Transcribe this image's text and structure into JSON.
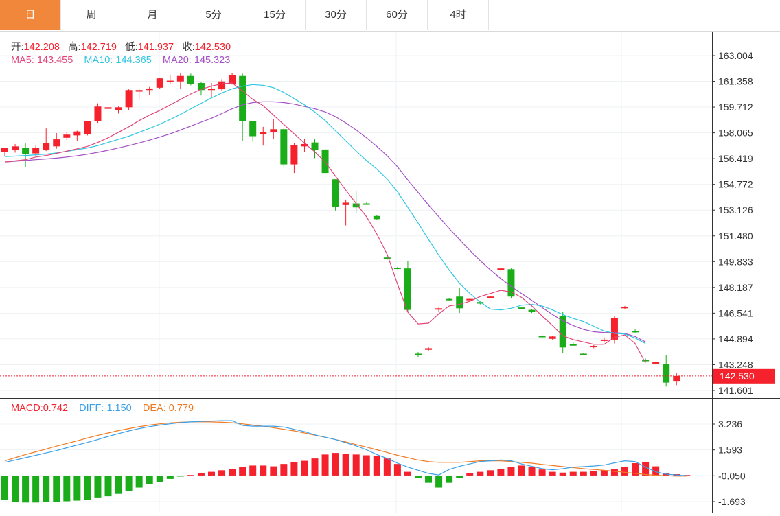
{
  "tabs": [
    "日",
    "周",
    "月",
    "5分",
    "15分",
    "30分",
    "60分",
    "4时"
  ],
  "active_tab": 0,
  "ohlc": {
    "open_label": "开:",
    "open": "142.208",
    "high_label": "高:",
    "high": "142.719",
    "low_label": "低:",
    "low": "141.937",
    "close_label": "收:",
    "close": "142.530"
  },
  "ma": {
    "ma5_label": "MA5:",
    "ma5": "143.455",
    "ma10_label": "MA10:",
    "ma10": "144.365",
    "ma20_label": "MA20:",
    "ma20": "145.323"
  },
  "macd": {
    "macd_label": "MACD:",
    "macd": "0.742",
    "diff_label": "DIFF:",
    "diff": "1.150",
    "dea_label": "DEA:",
    "dea": "0.779"
  },
  "colors": {
    "up": "#f5222d",
    "down": "#1aad19",
    "ma5": "#e0457b",
    "ma10": "#2ec7e0",
    "ma20": "#a34fc4",
    "diff": "#3aa0e8",
    "dea": "#f07a22",
    "active_tab": "#f0873a"
  },
  "chart_data": [
    {
      "type": "candlestick",
      "price_axis_ticks": [
        "163.004",
        "161.358",
        "159.712",
        "158.065",
        "156.419",
        "154.772",
        "153.126",
        "151.480",
        "149.833",
        "148.187",
        "146.541",
        "144.894",
        "143.248",
        "141.601"
      ],
      "ylim": [
        141.0,
        164.0
      ],
      "last_price_label": "142.530",
      "last_price": 142.53,
      "grid": true,
      "candles": [
        {
          "o": 156.85,
          "h": 157.1,
          "l": 156.55,
          "c": 157.1
        },
        {
          "o": 156.95,
          "h": 157.35,
          "l": 156.8,
          "c": 157.2
        },
        {
          "o": 157.1,
          "h": 157.4,
          "l": 155.9,
          "c": 156.7
        },
        {
          "o": 156.75,
          "h": 157.25,
          "l": 156.55,
          "c": 157.1
        },
        {
          "o": 156.95,
          "h": 158.35,
          "l": 156.9,
          "c": 157.4
        },
        {
          "o": 157.2,
          "h": 158.05,
          "l": 157.05,
          "c": 157.65
        },
        {
          "o": 157.75,
          "h": 158.1,
          "l": 157.6,
          "c": 157.95
        },
        {
          "o": 157.9,
          "h": 158.2,
          "l": 157.55,
          "c": 158.15
        },
        {
          "o": 158.0,
          "h": 158.8,
          "l": 157.9,
          "c": 158.8
        },
        {
          "o": 158.8,
          "h": 159.95,
          "l": 158.7,
          "c": 159.75
        },
        {
          "o": 159.6,
          "h": 160.0,
          "l": 159.05,
          "c": 159.7
        },
        {
          "o": 159.5,
          "h": 159.75,
          "l": 159.3,
          "c": 159.7
        },
        {
          "o": 159.7,
          "h": 160.85,
          "l": 159.5,
          "c": 160.8
        },
        {
          "o": 160.7,
          "h": 160.9,
          "l": 160.2,
          "c": 160.8
        },
        {
          "o": 160.8,
          "h": 161.0,
          "l": 160.5,
          "c": 160.9
        },
        {
          "o": 160.95,
          "h": 161.6,
          "l": 160.85,
          "c": 161.55
        },
        {
          "o": 161.35,
          "h": 161.75,
          "l": 161.15,
          "c": 161.4
        },
        {
          "o": 161.35,
          "h": 161.9,
          "l": 160.85,
          "c": 161.7
        },
        {
          "o": 161.7,
          "h": 161.85,
          "l": 161.1,
          "c": 161.2
        },
        {
          "o": 161.25,
          "h": 161.3,
          "l": 160.45,
          "c": 160.8
        },
        {
          "o": 160.8,
          "h": 161.25,
          "l": 160.35,
          "c": 160.9
        },
        {
          "o": 160.85,
          "h": 161.5,
          "l": 160.75,
          "c": 161.35
        },
        {
          "o": 161.2,
          "h": 161.9,
          "l": 161.15,
          "c": 161.75
        },
        {
          "o": 161.7,
          "h": 161.85,
          "l": 157.55,
          "c": 158.8
        },
        {
          "o": 158.8,
          "h": 158.8,
          "l": 157.5,
          "c": 157.85
        },
        {
          "o": 158.0,
          "h": 158.45,
          "l": 157.25,
          "c": 158.1
        },
        {
          "o": 158.1,
          "h": 158.95,
          "l": 157.65,
          "c": 158.3
        },
        {
          "o": 158.3,
          "h": 158.4,
          "l": 155.9,
          "c": 156.05
        },
        {
          "o": 156.05,
          "h": 157.4,
          "l": 155.5,
          "c": 157.3
        },
        {
          "o": 157.2,
          "h": 157.7,
          "l": 156.85,
          "c": 157.35
        },
        {
          "o": 157.45,
          "h": 157.65,
          "l": 156.45,
          "c": 156.95
        },
        {
          "o": 157.0,
          "h": 157.05,
          "l": 155.4,
          "c": 155.5
        },
        {
          "o": 155.1,
          "h": 155.1,
          "l": 153.1,
          "c": 153.35
        },
        {
          "o": 153.45,
          "h": 153.8,
          "l": 152.15,
          "c": 153.6
        },
        {
          "o": 153.55,
          "h": 154.35,
          "l": 152.95,
          "c": 153.3
        },
        {
          "o": 153.55,
          "h": 153.6,
          "l": 153.5,
          "c": 153.5
        },
        {
          "o": 152.75,
          "h": 152.8,
          "l": 152.5,
          "c": 152.55
        },
        {
          "o": 150.1,
          "h": 150.15,
          "l": 149.95,
          "c": 150.0
        },
        {
          "o": 149.45,
          "h": 149.5,
          "l": 149.35,
          "c": 149.4
        },
        {
          "o": 149.4,
          "h": 149.85,
          "l": 146.6,
          "c": 146.75
        },
        {
          "o": 143.95,
          "h": 144.05,
          "l": 143.75,
          "c": 143.85
        },
        {
          "o": 144.2,
          "h": 144.4,
          "l": 144.1,
          "c": 144.3
        },
        {
          "o": 146.8,
          "h": 146.9,
          "l": 146.6,
          "c": 146.85
        },
        {
          "o": 147.45,
          "h": 147.5,
          "l": 147.35,
          "c": 147.4
        },
        {
          "o": 147.6,
          "h": 148.15,
          "l": 146.55,
          "c": 146.85
        },
        {
          "o": 147.45,
          "h": 147.5,
          "l": 147.4,
          "c": 147.45
        },
        {
          "o": 147.25,
          "h": 147.3,
          "l": 147.1,
          "c": 147.15
        },
        {
          "o": 147.55,
          "h": 147.65,
          "l": 147.5,
          "c": 147.6
        },
        {
          "o": 149.35,
          "h": 149.45,
          "l": 149.2,
          "c": 149.4
        },
        {
          "o": 149.35,
          "h": 149.4,
          "l": 147.5,
          "c": 147.6
        },
        {
          "o": 146.9,
          "h": 146.95,
          "l": 146.8,
          "c": 146.85
        },
        {
          "o": 146.75,
          "h": 146.8,
          "l": 146.55,
          "c": 146.6
        },
        {
          "o": 145.1,
          "h": 145.2,
          "l": 144.9,
          "c": 145.0
        },
        {
          "o": 144.9,
          "h": 145.1,
          "l": 144.85,
          "c": 145.05
        },
        {
          "o": 146.35,
          "h": 146.6,
          "l": 144.0,
          "c": 144.35
        },
        {
          "o": 144.55,
          "h": 144.7,
          "l": 144.45,
          "c": 144.5
        },
        {
          "o": 143.95,
          "h": 144.0,
          "l": 143.85,
          "c": 143.9
        },
        {
          "o": 144.4,
          "h": 144.5,
          "l": 144.3,
          "c": 144.45
        },
        {
          "o": 144.8,
          "h": 145.0,
          "l": 144.7,
          "c": 144.85
        },
        {
          "o": 144.85,
          "h": 146.35,
          "l": 144.6,
          "c": 146.25
        },
        {
          "o": 146.85,
          "h": 147.0,
          "l": 146.8,
          "c": 146.95
        },
        {
          "o": 145.4,
          "h": 145.5,
          "l": 145.25,
          "c": 145.35
        },
        {
          "o": 143.55,
          "h": 143.65,
          "l": 143.45,
          "c": 143.5
        },
        {
          "o": 143.35,
          "h": 143.45,
          "l": 143.3,
          "c": 143.4
        },
        {
          "o": 143.3,
          "h": 143.85,
          "l": 141.85,
          "c": 142.1
        },
        {
          "o": 142.21,
          "h": 142.72,
          "l": 141.94,
          "c": 142.53
        }
      ],
      "ma5": [
        156.2,
        156.28,
        156.35,
        156.52,
        156.62,
        156.75,
        156.9,
        157.05,
        157.2,
        157.45,
        157.75,
        158.1,
        158.45,
        158.85,
        159.2,
        159.5,
        159.85,
        160.2,
        160.55,
        160.85,
        161.05,
        161.2,
        161.25,
        160.75,
        160.2,
        159.8,
        159.2,
        158.6,
        158.0,
        157.4,
        156.85,
        156.2,
        155.3,
        154.4,
        153.55,
        152.7,
        151.6,
        150.3,
        148.4,
        146.6,
        145.85,
        145.9,
        146.5,
        147.0,
        147.1,
        147.3,
        147.6,
        147.8,
        148.0,
        147.9,
        147.55,
        147.0,
        146.35,
        145.75,
        145.1,
        144.85,
        144.7,
        144.55,
        144.55,
        145.0,
        145.15,
        144.6,
        143.35
      ],
      "ma10": [
        156.55,
        156.58,
        156.62,
        156.66,
        156.7,
        156.78,
        156.88,
        156.99,
        157.1,
        157.25,
        157.45,
        157.65,
        157.85,
        158.1,
        158.35,
        158.62,
        158.92,
        159.25,
        159.6,
        159.95,
        160.3,
        160.62,
        160.88,
        161.05,
        161.15,
        161.1,
        160.95,
        160.65,
        160.25,
        159.85,
        159.4,
        158.85,
        158.2,
        157.55,
        156.9,
        156.3,
        155.75,
        155.1,
        154.3,
        153.3,
        152.3,
        151.25,
        150.25,
        149.3,
        148.45,
        147.8,
        147.25,
        146.8,
        146.75,
        146.85,
        147.05,
        147.1,
        147.0,
        146.75,
        146.45,
        146.2,
        146.0,
        145.7,
        145.4,
        145.25,
        145.2,
        144.95,
        144.6
      ],
      "ma20": [
        156.2,
        156.25,
        156.3,
        156.35,
        156.4,
        156.45,
        156.52,
        156.6,
        156.7,
        156.82,
        156.95,
        157.1,
        157.25,
        157.42,
        157.6,
        157.8,
        158.0,
        158.25,
        158.5,
        158.75,
        159.0,
        159.3,
        159.6,
        159.85,
        160.0,
        160.05,
        160.05,
        160.0,
        159.9,
        159.75,
        159.6,
        159.4,
        159.1,
        158.7,
        158.25,
        157.75,
        157.2,
        156.6,
        155.9,
        155.05,
        154.25,
        153.45,
        152.7,
        151.95,
        151.25,
        150.55,
        149.9,
        149.3,
        148.75,
        148.25,
        147.8,
        147.35,
        146.9,
        146.45,
        146.05,
        145.75,
        145.5,
        145.35,
        145.3,
        145.3,
        145.25,
        145.05,
        144.7
      ]
    },
    {
      "type": "bar",
      "indicator": "MACD",
      "axis_ticks": [
        "3.236",
        "1.593",
        "-0.050",
        "-1.693"
      ],
      "ylim": [
        -2.2,
        3.8
      ],
      "histogram": [
        -1.55,
        -1.65,
        -1.7,
        -1.7,
        -1.68,
        -1.65,
        -1.62,
        -1.58,
        -1.52,
        -1.42,
        -1.3,
        -1.15,
        -0.95,
        -0.75,
        -0.55,
        -0.4,
        -0.2,
        -0.05,
        0.05,
        0.15,
        0.25,
        0.35,
        0.45,
        0.55,
        0.65,
        0.65,
        0.6,
        0.75,
        0.85,
        0.95,
        1.1,
        1.35,
        1.45,
        1.4,
        1.35,
        1.3,
        1.25,
        1.1,
        0.75,
        0.25,
        -0.15,
        -0.45,
        -0.75,
        -0.45,
        -0.15,
        0.15,
        0.25,
        0.35,
        0.45,
        0.55,
        0.65,
        0.55,
        0.4,
        0.25,
        0.2,
        0.25,
        0.25,
        0.3,
        0.35,
        0.45,
        0.55,
        0.8,
        0.85,
        0.6,
        0.15,
        0.1,
        0.05
      ],
      "diff": [
        0.85,
        1.0,
        1.15,
        1.3,
        1.45,
        1.6,
        1.78,
        1.95,
        2.12,
        2.3,
        2.5,
        2.68,
        2.85,
        3.0,
        3.12,
        3.22,
        3.3,
        3.38,
        3.42,
        3.45,
        3.48,
        3.5,
        3.5,
        3.2,
        3.15,
        3.15,
        3.15,
        3.1,
        2.95,
        2.8,
        2.6,
        2.45,
        2.3,
        2.1,
        1.9,
        1.65,
        1.35,
        1.1,
        0.8,
        0.55,
        0.35,
        0.15,
        0.05,
        0.4,
        0.6,
        0.75,
        0.9,
        0.95,
        1.0,
        0.95,
        0.75,
        0.6,
        0.45,
        0.38,
        0.45,
        0.55,
        0.58,
        0.62,
        0.68,
        0.82,
        0.95,
        0.9,
        0.55,
        0.25,
        0.1,
        0.05,
        0.0
      ],
      "dea": [
        0.95,
        1.15,
        1.35,
        1.52,
        1.7,
        1.88,
        2.05,
        2.22,
        2.4,
        2.57,
        2.72,
        2.87,
        3.0,
        3.12,
        3.22,
        3.3,
        3.36,
        3.4,
        3.42,
        3.43,
        3.42,
        3.4,
        3.37,
        3.3,
        3.22,
        3.15,
        3.05,
        2.95,
        2.85,
        2.72,
        2.58,
        2.45,
        2.3,
        2.15,
        1.98,
        1.82,
        1.65,
        1.48,
        1.3,
        1.15,
        1.0,
        0.9,
        0.85,
        0.85,
        0.85,
        0.9,
        0.95,
        0.95,
        0.95,
        0.9,
        0.85,
        0.8,
        0.72,
        0.65,
        0.58,
        0.52,
        0.45,
        0.4,
        0.35,
        0.28,
        0.22,
        0.15,
        0.08,
        0.03,
        0.0,
        -0.02,
        -0.02
      ]
    }
  ]
}
